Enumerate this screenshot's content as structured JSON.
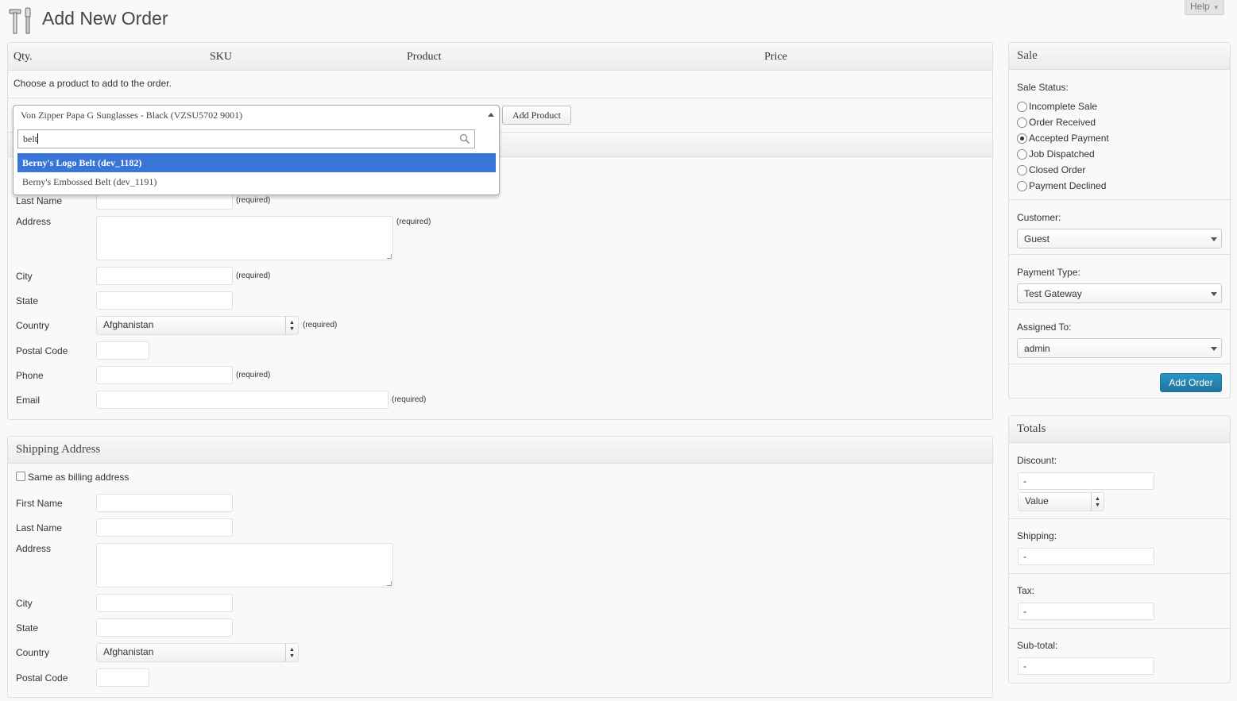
{
  "header": {
    "title": "Add New Order",
    "help_label": "Help",
    "help_arrow": "▼"
  },
  "products": {
    "columns": [
      "Qty.",
      "SKU",
      "Product",
      "Price"
    ],
    "instruction": "Choose a product to add to the order.",
    "selected_product": "Von Zipper Papa G Sunglasses - Black (VZSU5702 9001)",
    "search_value": "belt",
    "results": [
      "Berny's Logo Belt (dev_1182)",
      "Berny's Embossed Belt (dev_1191)"
    ],
    "add_button": "Add Product"
  },
  "billing": {
    "last_name_label": "Last Name",
    "address_label": "Address",
    "city_label": "City",
    "state_label": "State",
    "country_label": "Country",
    "country_value": "Afghanistan",
    "postal_label": "Postal Code",
    "phone_label": "Phone",
    "email_label": "Email",
    "required_text": "(required)"
  },
  "shipping": {
    "title": "Shipping Address",
    "same_as_billing": "Same as billing address",
    "first_name_label": "First Name",
    "last_name_label": "Last Name",
    "address_label": "Address",
    "city_label": "City",
    "state_label": "State",
    "country_label": "Country",
    "country_value": "Afghanistan",
    "postal_label": "Postal Code"
  },
  "sale": {
    "title": "Sale",
    "status_label": "Sale Status:",
    "statuses": [
      "Incomplete Sale",
      "Order Received",
      "Accepted Payment",
      "Job Dispatched",
      "Closed Order",
      "Payment Declined"
    ],
    "selected_status": "Accepted Payment",
    "customer_label": "Customer:",
    "customer_value": "Guest",
    "payment_type_label": "Payment Type:",
    "payment_type_value": "Test Gateway",
    "assigned_label": "Assigned To:",
    "assigned_value": "admin",
    "add_order_button": "Add Order"
  },
  "totals": {
    "title": "Totals",
    "discount_label": "Discount:",
    "discount_value": "-",
    "discount_type": "Value",
    "shipping_label": "Shipping:",
    "shipping_value": "-",
    "tax_label": "Tax:",
    "tax_value": "-",
    "subtotal_label": "Sub-total:",
    "subtotal_value": "-"
  },
  "colors": {
    "accent_blue": "#21759b",
    "highlight_blue": "#3875d7"
  }
}
